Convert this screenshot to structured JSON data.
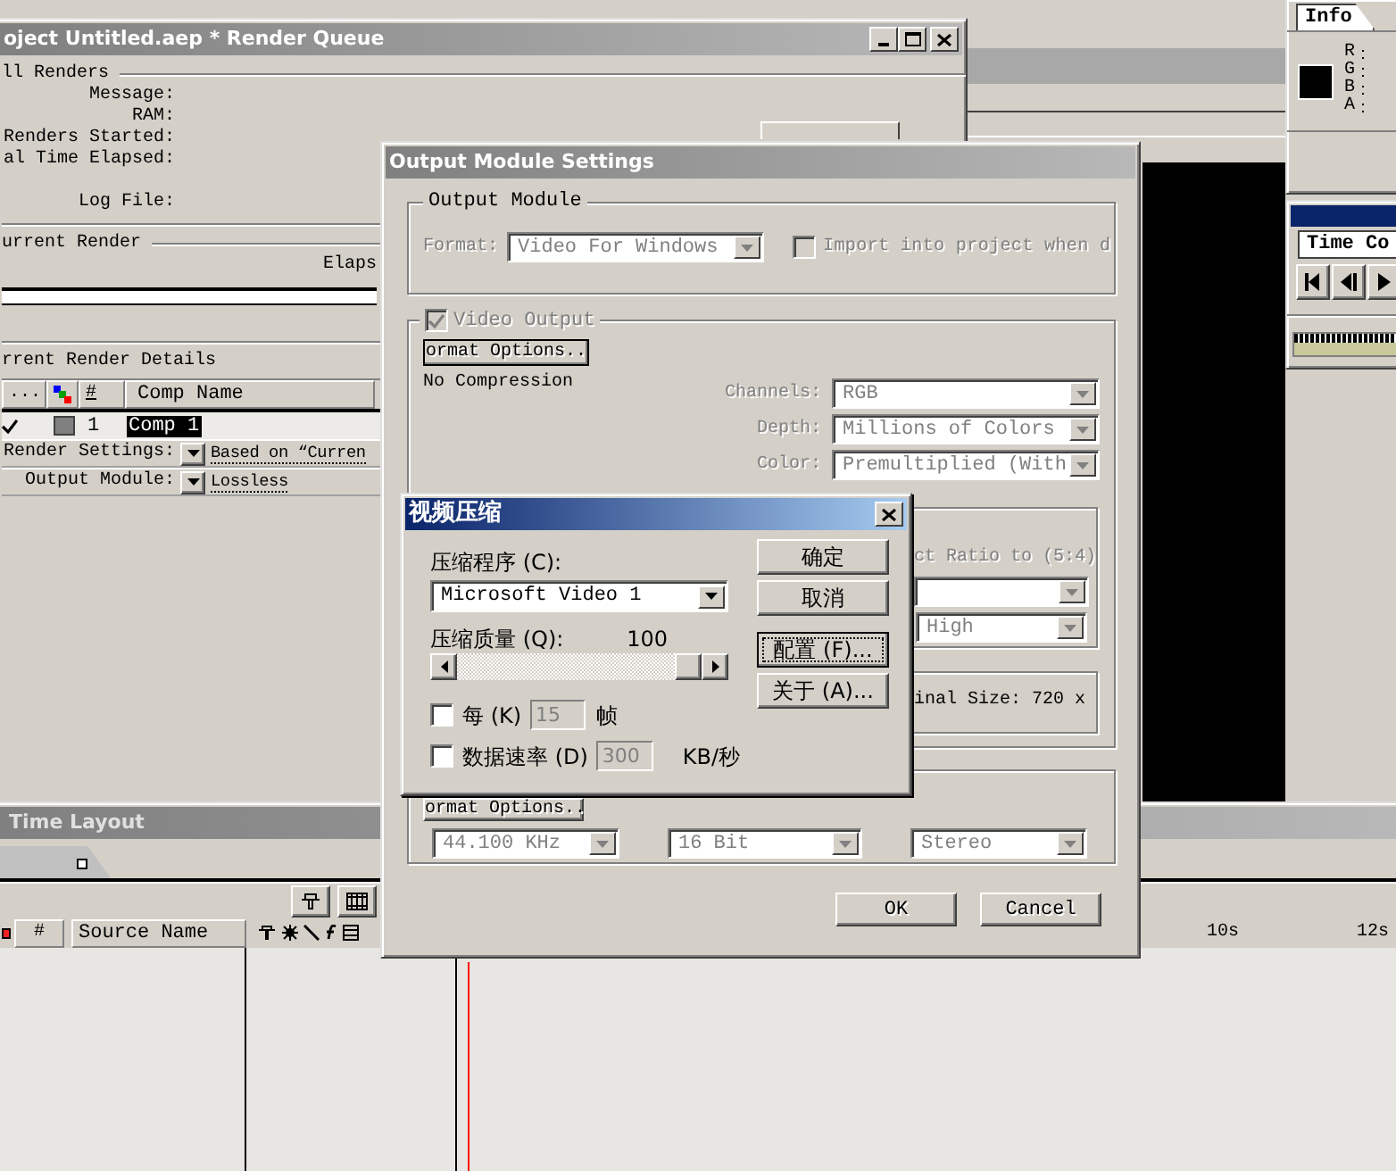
{
  "render_queue": {
    "title": "oject Untitled.aep * Render Queue",
    "all_renders_heading": "ll Renders",
    "fields": [
      "Message:",
      "RAM:",
      "Renders Started:",
      "al Time Elapsed:"
    ],
    "log_file_label": "Log File:",
    "current_render_heading": "urrent Render",
    "elapsed_label": "Elaps",
    "progress": {
      "level": 0
    },
    "details_heading": "rrent Render Details",
    "columns": [
      "...",
      "#",
      "Comp Name"
    ],
    "item": {
      "checked": true,
      "number": "1",
      "comp_name": "Comp 1",
      "selected": true
    },
    "settings": [
      {
        "label": "Render Settings:",
        "value": "Based on “Curren"
      },
      {
        "label": "Output Module:",
        "value": "Lossless"
      }
    ]
  },
  "info_panel": {
    "tab": "Info",
    "channels": [
      "R",
      "G",
      "B",
      "A"
    ]
  },
  "time_controls": {
    "tab": "Time Co"
  },
  "time_layout": {
    "title": "Time Layout",
    "columns": [
      "#",
      "Source Name"
    ],
    "time_labels": [
      "10s",
      "12s"
    ]
  },
  "output_module_dialog": {
    "title": "Output Module Settings",
    "output_module": {
      "heading": "Output Module",
      "format_label": "Format:",
      "format_value": "Video For Windows",
      "import_label": "Import into project when d",
      "import_checked": false
    },
    "video_output": {
      "label": "Video Output",
      "checked": true,
      "format_options": "ormat Options..",
      "compression": "No Compression",
      "fields": [
        {
          "label": "Channels:",
          "value": "RGB"
        },
        {
          "label": "Depth:",
          "value": "Millions of Colors"
        },
        {
          "label": "Color:",
          "value": "Premultiplied (With"
        }
      ],
      "aspect_label": "ct Ratio to (5:4)",
      "quality_value": "High",
      "size_label": "inal Size: 720 x"
    },
    "audio_output": {
      "format_options": "ormat Options..",
      "selects": [
        "44.100 KHz",
        "16 Bit",
        "Stereo"
      ]
    },
    "buttons": [
      "OK",
      "Cancel"
    ]
  },
  "compression_dialog": {
    "title": "视频压缩",
    "compressor_label": "压缩程序 (C):",
    "compressor_value": "Microsoft Video 1",
    "quality_label": "压缩质量 (Q):",
    "quality_value": "100",
    "quality_slider": {
      "level": 1.0
    },
    "options": [
      {
        "label": "每 (K)",
        "value": "15",
        "unit": "帧",
        "checked": false
      },
      {
        "label": "数据速率 (D)",
        "value": "300",
        "unit": "KB/秒",
        "checked": false
      }
    ],
    "buttons": [
      {
        "label": "确定",
        "focused": false
      },
      {
        "label": "取消",
        "focused": false
      },
      {
        "label": "配置 (F)...",
        "focused": true
      },
      {
        "label": "关于 (A)...",
        "focused": false
      }
    ]
  }
}
